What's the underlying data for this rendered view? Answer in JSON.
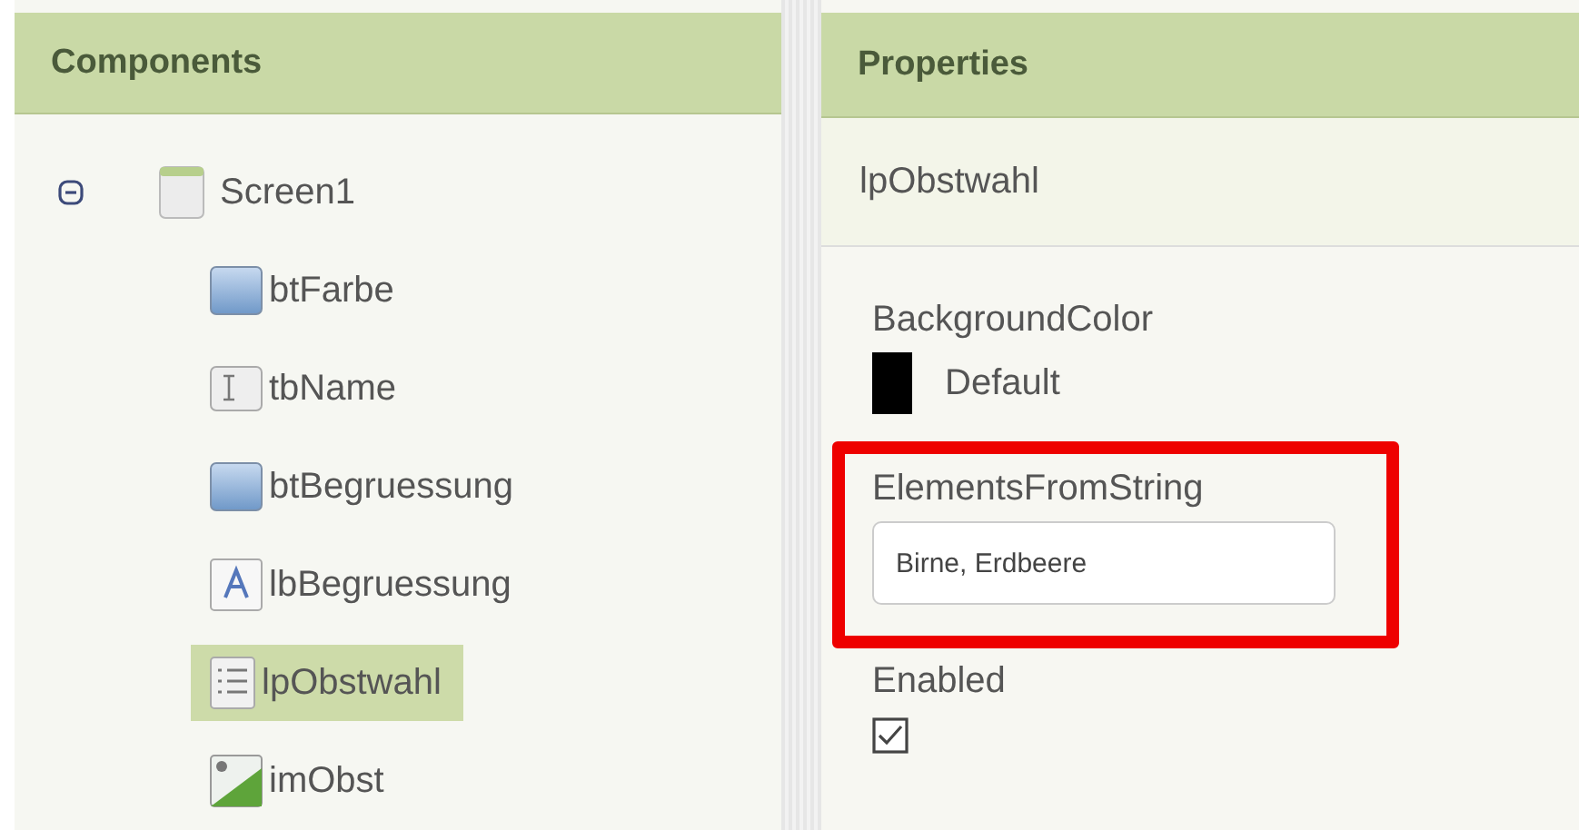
{
  "components": {
    "title": "Components",
    "tree": [
      {
        "label": "Screen1",
        "kind": "screen",
        "expanded": true,
        "selected": false,
        "children": [
          {
            "label": "btFarbe",
            "kind": "button",
            "selected": false
          },
          {
            "label": "tbName",
            "kind": "textbox",
            "selected": false
          },
          {
            "label": "btBegruessung",
            "kind": "button",
            "selected": false
          },
          {
            "label": "lbBegruessung",
            "kind": "label",
            "selected": false
          },
          {
            "label": "lpObstwahl",
            "kind": "listpicker",
            "selected": true
          },
          {
            "label": "imObst",
            "kind": "image",
            "selected": false
          }
        ]
      }
    ]
  },
  "properties": {
    "title": "Properties",
    "component": "lpObstwahl",
    "items": [
      {
        "kind": "color",
        "label": "BackgroundColor",
        "value": "Default",
        "highlighted": false
      },
      {
        "kind": "text",
        "label": "ElementsFromString",
        "value": "Birne, Erdbeere",
        "highlighted": true
      },
      {
        "kind": "checkbox",
        "label": "Enabled",
        "checked": true,
        "highlighted": false
      }
    ]
  }
}
